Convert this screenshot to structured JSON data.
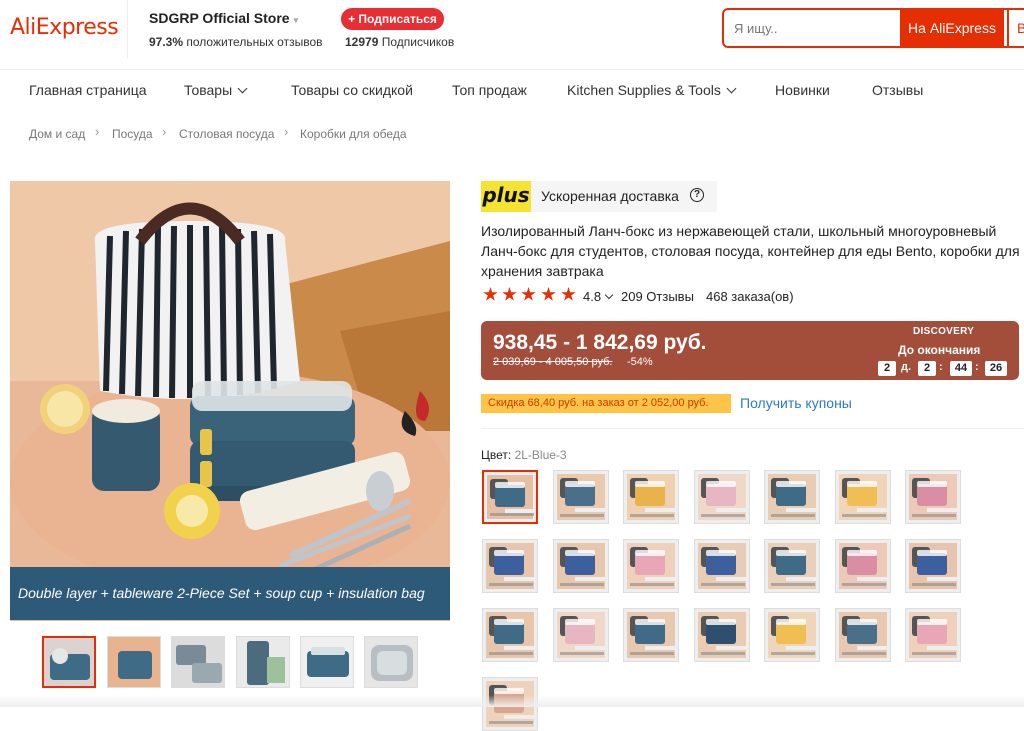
{
  "header": {
    "logo": "AliExpress",
    "store_name": "SDGRP Official Store",
    "store_caret": "▾",
    "feedback_percent": "97.3%",
    "feedback_text": "положительных отзывов",
    "subscribers_count": "12979",
    "subscribers_text": "Подписчиков",
    "subscribe_button": "+ Подписаться",
    "search_placeholder": "Я ищу..",
    "search_button": "На AliExpress",
    "search_button_2": "В"
  },
  "nav": {
    "items": [
      {
        "label": "Главная страница",
        "has_dropdown": false
      },
      {
        "label": "Товары",
        "has_dropdown": true
      },
      {
        "label": "Товары со скидкой",
        "has_dropdown": false
      },
      {
        "label": "Топ продаж",
        "has_dropdown": false
      },
      {
        "label": "Kitchen Supplies & Tools",
        "has_dropdown": true
      },
      {
        "label": "Новинки",
        "has_dropdown": false
      },
      {
        "label": "Отзывы",
        "has_dropdown": false
      }
    ]
  },
  "breadcrumb": [
    "Дом и сад",
    "Посуда",
    "Столовая посуда",
    "Коробки для обеда"
  ],
  "gallery": {
    "caption": "Double layer + tableware 2-Piece Set + soup cup + insulation bag",
    "thumbnails": 6,
    "selected_thumbnail": 0
  },
  "product": {
    "plus_badge": "plus",
    "plus_text": "Ускоренная доставка",
    "help_icon": "?",
    "title": "Изолированный Ланч-бокс из нержавеющей стали, школьный многоуровневый Ланч-бокс для студентов, столовая посуда, контейнер для еды Bento, коробки для хранения завтрака",
    "rating": "4.8",
    "stars": 5,
    "reviews": "209 Отзывы",
    "orders": "468 заказа(ов)",
    "price": "938,45 - 1 842,69 руб.",
    "old_price": "2 039,69 - 4 005,50 руб.",
    "discount": "-54%",
    "promo_label": "DISCOVERY",
    "until_label": "До окончания",
    "timer": {
      "days": "2",
      "days_label": "д.",
      "hours": "2",
      "minutes": "44",
      "seconds": "26"
    },
    "coupon_text": "Скидка 68,40 руб. на заказ от 2 052,00 руб.",
    "coupon_link": "Получить купоны",
    "color_label": "Цвет:",
    "color_value": "2L-Blue-3"
  },
  "colors": {
    "brand_red": "#e62e04",
    "price_bg": "#a34e3b",
    "plus_yellow": "#f5e32f",
    "coupon_bg": "#fdc448",
    "link_blue": "#2c7ac6",
    "caption_bg": "#2d5a78"
  },
  "swatches": [
    {
      "box": "#3f6b86",
      "bg": "#e6c0a6"
    },
    {
      "box": "#4a6f8a",
      "bg": "#eac9ae"
    },
    {
      "box": "#e9b24a",
      "bg": "#efd0b2"
    },
    {
      "box": "#e8b6c3",
      "bg": "#f0d8c8"
    },
    {
      "box": "#3f6b86",
      "bg": "#e9ccb4"
    },
    {
      "box": "#f0be52",
      "bg": "#efd6bb"
    },
    {
      "box": "#d98ea3",
      "bg": "#eccab7"
    },
    {
      "box": "#3e5f9e",
      "bg": "#e6c6ad"
    },
    {
      "box": "#3e5f9e",
      "bg": "#e8c7ad"
    },
    {
      "box": "#e8a6b7",
      "bg": "#eed0bc"
    },
    {
      "box": "#3e5f9e",
      "bg": "#e9ccb4"
    },
    {
      "box": "#3f6b86",
      "bg": "#ead0b8"
    },
    {
      "box": "#d98ea3",
      "bg": "#eccab7"
    },
    {
      "box": "#3e5f9e",
      "bg": "#e7c4ab"
    },
    {
      "box": "#3f6b86",
      "bg": "#e8c6ac"
    },
    {
      "box": "#e8b6c3",
      "bg": "#f0d8c8"
    },
    {
      "box": "#3f6b86",
      "bg": "#e8c9b0"
    },
    {
      "box": "#2e4f6e",
      "bg": "#e9ccb2"
    },
    {
      "box": "#f0be52",
      "bg": "#efd6bb"
    },
    {
      "box": "#4a6f8a",
      "bg": "#e8c8ae"
    },
    {
      "box": "#e8a6b7",
      "bg": "#eed0bc"
    },
    {
      "box": "#d9a58c",
      "bg": "#efd2bc"
    }
  ]
}
